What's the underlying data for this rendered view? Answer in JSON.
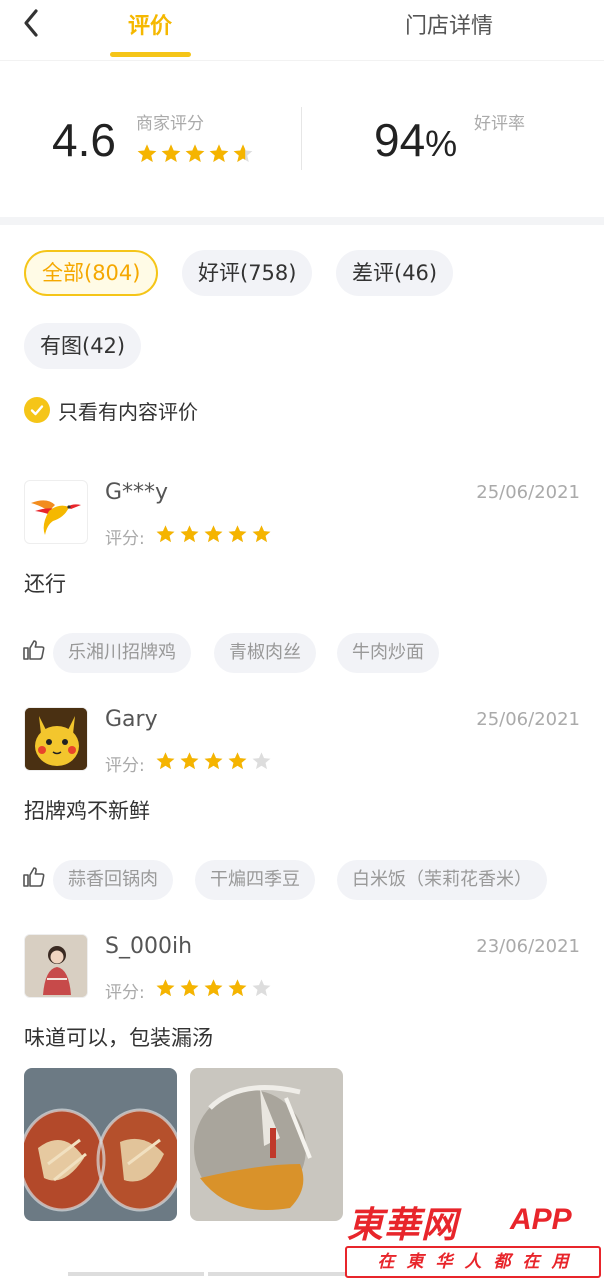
{
  "header": {
    "tab_reviews": "评价",
    "tab_store": "门店详情"
  },
  "summary": {
    "score": "4.6",
    "score_label": "商家评分",
    "score_stars": 4.6,
    "rate_value": "94",
    "rate_unit": "%",
    "rate_label": "好评率"
  },
  "filters": {
    "all": "全部(804)",
    "good": "好评(758)",
    "bad": "差评(46)",
    "photos": "有图(42)",
    "content_only": "只看有内容评价"
  },
  "reviews": [
    {
      "user": "G***y",
      "date": "25/06/2021",
      "rating_label": "评分:",
      "stars": 5,
      "text": "还行",
      "dishes": [
        "乐湘川招牌鸡",
        "青椒肉丝",
        "牛肉炒面"
      ]
    },
    {
      "user": "Gary",
      "date": "25/06/2021",
      "rating_label": "评分:",
      "stars": 4,
      "text": "招牌鸡不新鲜",
      "dishes": [
        "蒜香回锅肉",
        "干煸四季豆",
        "白米饭（茉莉花香米）"
      ]
    },
    {
      "user": "S_000ih",
      "date": "23/06/2021",
      "rating_label": "评分:",
      "stars": 4,
      "text": "味道可以，包装漏汤"
    }
  ],
  "watermark": {
    "brand": "東華网",
    "app": "APP",
    "slogan": "在東华人都在用"
  },
  "colors": {
    "accent": "#f5c518",
    "star_on": "#f5b400",
    "star_off": "#dddddd",
    "watermark": "#e8252b"
  }
}
